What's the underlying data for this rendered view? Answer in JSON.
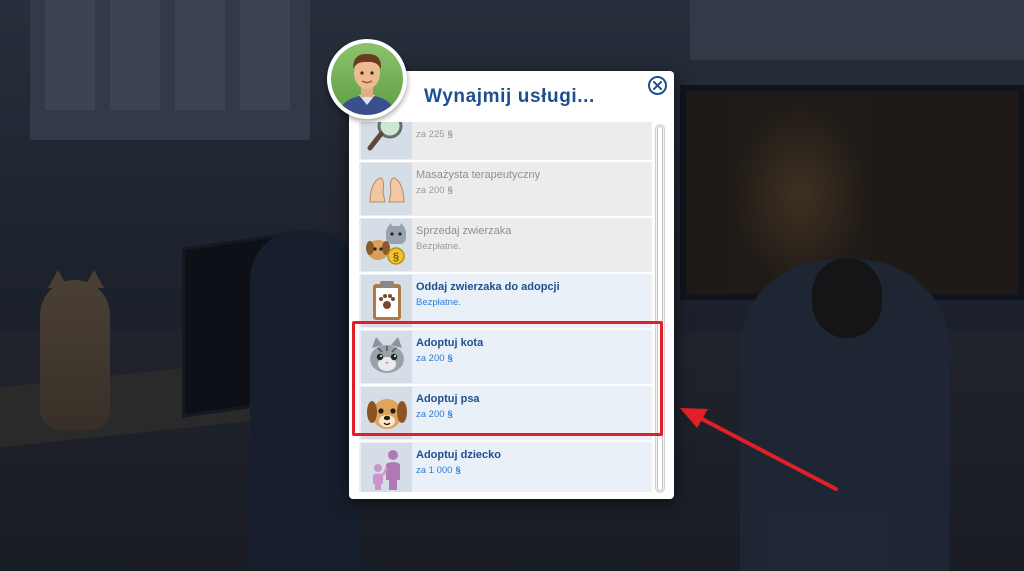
{
  "dialog": {
    "title": "Wynajmij usługi..."
  },
  "services": [
    {
      "name": "",
      "price": "za 225",
      "currency": "§",
      "icon": "magnifier-icon",
      "state": "unavailable"
    },
    {
      "name": "Masażysta terapeutyczny",
      "price": "za 200",
      "currency": "§",
      "icon": "feet-massage-icon",
      "state": "unavailable"
    },
    {
      "name": "Sprzedaj zwierzaka",
      "price": "Bezpłatne.",
      "currency": "",
      "icon": "sell-pet-icon",
      "state": "unavailable"
    },
    {
      "name": "Oddaj zwierzaka do adopcji",
      "price": "Bezpłatne.",
      "currency": "",
      "icon": "clipboard-paw-icon",
      "state": "available"
    },
    {
      "name": "Adoptuj kota",
      "price": "za 200",
      "currency": "§",
      "icon": "cat-face-icon",
      "state": "available"
    },
    {
      "name": "Adoptuj psa",
      "price": "za 200",
      "currency": "§",
      "icon": "dog-face-icon",
      "state": "available"
    },
    {
      "name": "Adoptuj dziecko",
      "price": "za 1 000",
      "currency": "§",
      "icon": "family-icon",
      "state": "available"
    }
  ],
  "colors": {
    "accent": "#1f4f8f",
    "price_blue": "#2f7ed8",
    "highlight_red": "#e01f26"
  }
}
